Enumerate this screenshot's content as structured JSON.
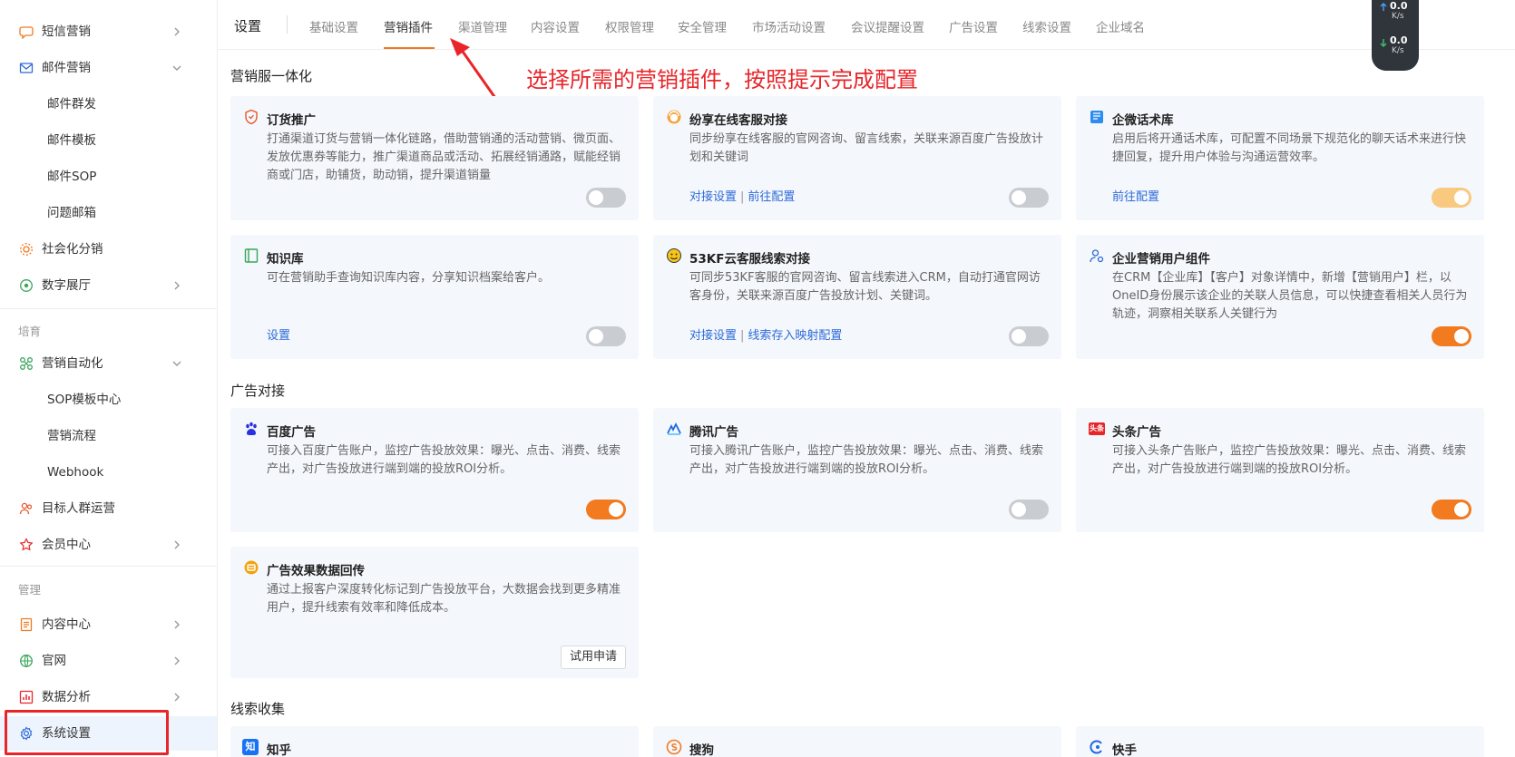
{
  "sidebar": {
    "items": [
      {
        "label": "短信营销"
      },
      {
        "label": "邮件营销"
      },
      {
        "label": "邮件群发"
      },
      {
        "label": "邮件模板"
      },
      {
        "label": "邮件SOP"
      },
      {
        "label": "问题邮箱"
      },
      {
        "label": "社会化分销"
      },
      {
        "label": "数字展厅"
      },
      {
        "label": "营销自动化"
      },
      {
        "label": "SOP模板中心"
      },
      {
        "label": "营销流程"
      },
      {
        "label": "Webhook"
      },
      {
        "label": "目标人群运营"
      },
      {
        "label": "会员中心"
      },
      {
        "label": "内容中心"
      },
      {
        "label": "官网"
      },
      {
        "label": "数据分析"
      },
      {
        "label": "系统设置"
      }
    ],
    "groups": {
      "cultivate": "培育",
      "manage": "管理"
    }
  },
  "header": {
    "title": "设置",
    "tabs": [
      "基础设置",
      "营销插件",
      "渠道管理",
      "内容设置",
      "权限管理",
      "安全管理",
      "市场活动设置",
      "会议提醒设置",
      "广告设置",
      "线索设置",
      "企业域名"
    ],
    "active_tab": "营销插件"
  },
  "speed": {
    "up": "0.0",
    "up_unit": "K/s",
    "down": "0.0",
    "down_unit": "K/s"
  },
  "annotation": "选择所需的营销插件，按照提示完成配置",
  "sections": {
    "s1": "营销服一体化",
    "s2": "广告对接",
    "s3": "线索收集"
  },
  "cards": {
    "c1": {
      "title": "订货推广",
      "desc": "打通渠道订货与营销一体化链路，借助营销通的活动营销、微页面、发放优惠券等能力，推广渠道商品或活动、拓展经销通路，赋能经销商或门店，助铺货，助动销，提升渠道销量",
      "toggle": "off"
    },
    "c2": {
      "title": "纷享在线客服对接",
      "desc": "同步纷享在线客服的官网咨询、留言线索，关联来源百度广告投放计划和关键词",
      "link1": "对接设置",
      "sep": "|",
      "link2": "前往配置",
      "toggle": "off"
    },
    "c3": {
      "title": "企微话术库",
      "desc": "启用后将开通话术库，可配置不同场景下规范化的聊天话术来进行快捷回复，提升用户体验与沟通运营效率。",
      "link1": "前往配置",
      "toggle": "on"
    },
    "c4": {
      "title": "知识库",
      "desc": "可在营销助手查询知识库内容，分享知识档案给客户。",
      "link1": "设置",
      "toggle": "off"
    },
    "c5": {
      "title": "53KF云客服线索对接",
      "desc": "可同步53KF客服的官网咨询、留言线索进入CRM，自动打通官网访客身份，关联来源百度广告投放计划、关键词。",
      "link1": "对接设置",
      "sep": "|",
      "link2": "线索存入映射配置",
      "toggle": "off"
    },
    "c6": {
      "title": "企业营销用户组件",
      "desc": "在CRM【企业库】【客户】对象详情中，新增【营销用户】栏，以OneID身份展示该企业的关联人员信息，可以快捷查看相关人员行为轨迹，洞察相关联系人关键行为",
      "toggle": "on"
    },
    "c7": {
      "title": "百度广告",
      "desc": "可接入百度广告账户，监控广告投放效果：曝光、点击、消费、线索产出，对广告投放进行端到端的投放ROI分析。",
      "toggle": "on"
    },
    "c8": {
      "title": "腾讯广告",
      "desc": "可接入腾讯广告账户，监控广告投放效果：曝光、点击、消费、线索产出，对广告投放进行端到端的投放ROI分析。",
      "toggle": "off"
    },
    "c9": {
      "title": "头条广告",
      "desc": "可接入头条广告账户，监控广告投放效果：曝光、点击、消费、线索产出，对广告投放进行端到端的投放ROI分析。",
      "toggle": "on",
      "logo_text": "头条"
    },
    "c10": {
      "title": "广告效果数据回传",
      "desc": "通过上报客户深度转化标记到广告投放平台，大数据会找到更多精准用户，提升线索有效率和降低成本。",
      "button": "试用申请"
    },
    "c11": {
      "title": "知乎",
      "logo_text": "知"
    },
    "c12": {
      "title": "搜狗"
    },
    "c13": {
      "title": "快手"
    }
  },
  "colors": {
    "accent": "#f27a1f",
    "link": "#2d6bd8",
    "annotation": "#e8262a",
    "card_bg": "#f4f7fc"
  }
}
